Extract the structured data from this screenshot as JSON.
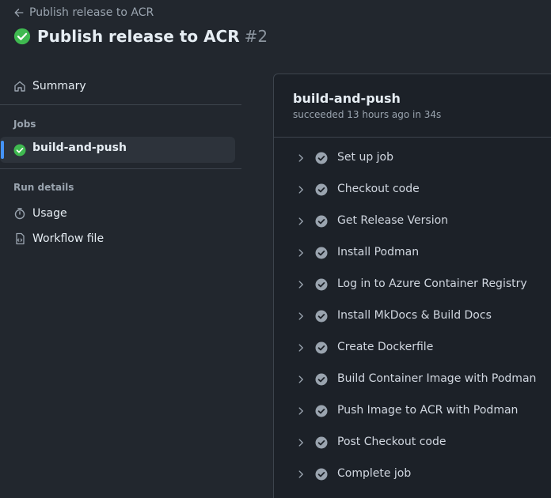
{
  "header": {
    "back_link": "Publish release to ACR",
    "title": "Publish release to ACR",
    "run_number": "#2"
  },
  "sidebar": {
    "summary": "Summary",
    "jobs_heading": "Jobs",
    "jobs": [
      {
        "label": "build-and-push",
        "status": "success"
      }
    ],
    "run_details_heading": "Run details",
    "details": [
      {
        "label": "Usage",
        "icon": "stopwatch-icon"
      },
      {
        "label": "Workflow file",
        "icon": "file-code-icon"
      }
    ]
  },
  "job": {
    "title": "build-and-push",
    "meta": "succeeded 13 hours ago in 34s",
    "steps": [
      {
        "label": "Set up job"
      },
      {
        "label": "Checkout code"
      },
      {
        "label": "Get Release Version"
      },
      {
        "label": "Install Podman"
      },
      {
        "label": "Log in to Azure Container Registry"
      },
      {
        "label": "Install MkDocs & Build Docs"
      },
      {
        "label": "Create Dockerfile"
      },
      {
        "label": "Build Container Image with Podman"
      },
      {
        "label": "Push Image to ACR with Podman"
      },
      {
        "label": "Post Checkout code"
      },
      {
        "label": "Complete job"
      }
    ]
  },
  "colors": {
    "success": "#3fb950",
    "accent": "#4493f8",
    "step_check": "#9aa4af"
  }
}
